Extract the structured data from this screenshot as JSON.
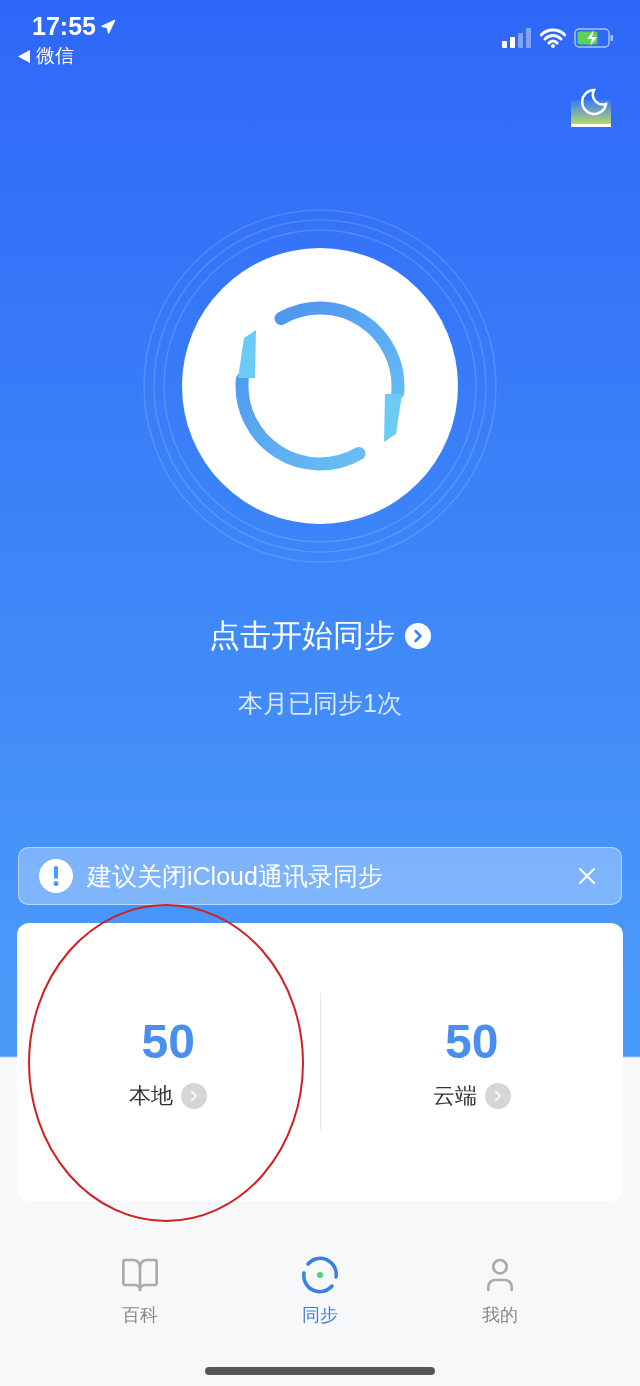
{
  "status_bar": {
    "time": "17:55",
    "back_label": "微信"
  },
  "sync": {
    "title": "点击开始同步",
    "subtitle": "本月已同步1次"
  },
  "notice": {
    "text": "建议关闭iCloud通讯录同步"
  },
  "counts": [
    {
      "value": "50",
      "label": "本地"
    },
    {
      "value": "50",
      "label": "云端"
    }
  ],
  "tabs": [
    {
      "label": "百科",
      "kind": "book",
      "selected": false
    },
    {
      "label": "同步",
      "kind": "sync",
      "selected": true
    },
    {
      "label": "我的",
      "kind": "person",
      "selected": false
    }
  ]
}
